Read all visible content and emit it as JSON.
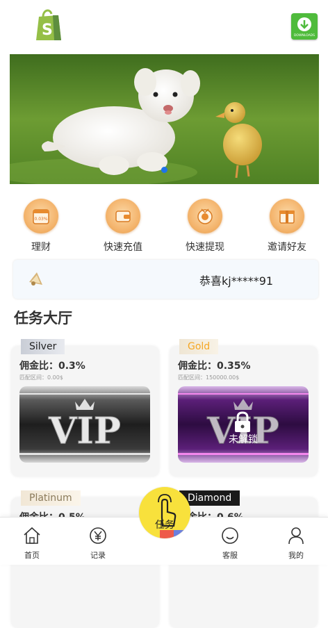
{
  "header": {
    "logo_icon": "shopify-bag-icon",
    "download_icon": "download-icon",
    "download_caption": "DOWNLOADS"
  },
  "banner": {
    "active_slide": 1
  },
  "actions": [
    {
      "label": "理财",
      "icon": "calendar-icon",
      "icon_text": "0.03%"
    },
    {
      "label": "快速充值",
      "icon": "wallet-icon"
    },
    {
      "label": "快速提现",
      "icon": "medal-icon"
    },
    {
      "label": "邀请好友",
      "icon": "gift-icon"
    }
  ],
  "notice": {
    "text": "恭喜kj*****91",
    "icon": "speaker-icon"
  },
  "section_title": "任务大厅",
  "cards": [
    {
      "tier": "Silver",
      "rate": "佣金比：0.3%",
      "range": "匹配区间：0.00$",
      "vip": "VIP",
      "locked": false
    },
    {
      "tier": "Gold",
      "rate": "佣金比：0.35%",
      "range": "匹配区间：150000.00$",
      "vip": "VIP",
      "locked": true,
      "lock_label": "未解锁"
    },
    {
      "tier": "Platinum",
      "rate": "佣金比：0.5%"
    },
    {
      "tier": "Diamond",
      "rate": "佣金比：0.6%"
    }
  ],
  "nav": {
    "home": "首页",
    "records": "记录",
    "task": "任务",
    "service": "客服",
    "mine": "我的"
  },
  "colors": {
    "accent": "#f8e13c",
    "action_orange": "#f4b56e",
    "gold_text": "#f5a623",
    "dot": "#1e74e8"
  }
}
